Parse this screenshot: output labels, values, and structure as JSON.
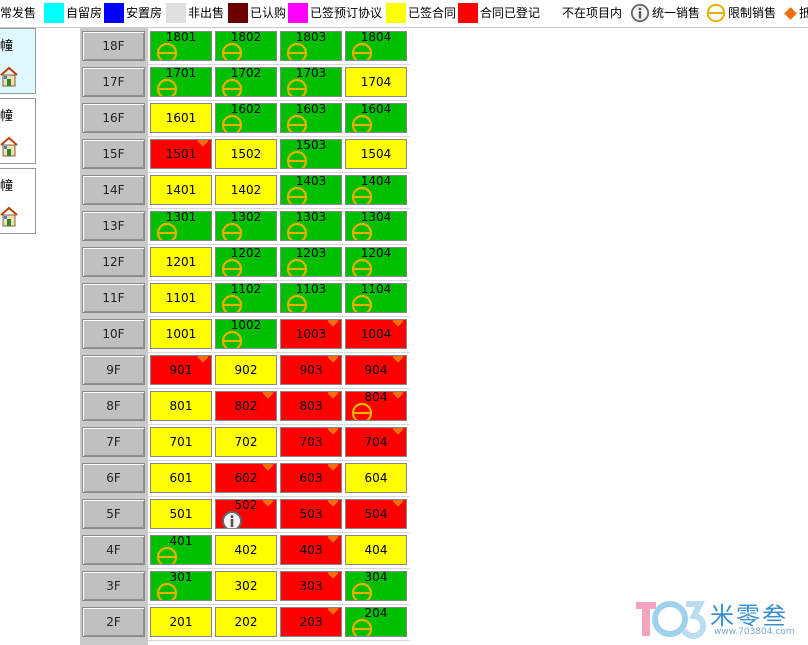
{
  "legend": {
    "items": [
      {
        "label": "正常发售",
        "color": "#00c000",
        "swatch": false
      },
      {
        "label": "自留房",
        "color": "#00ffff",
        "swatch": true
      },
      {
        "label": "安置房",
        "color": "#0000ff",
        "swatch": true
      },
      {
        "label": "非出售",
        "color": "#e0e0e0",
        "swatch": true
      },
      {
        "label": "已认购",
        "color": "#6a0000",
        "swatch": true
      },
      {
        "label": "已签预订协议",
        "color": "#ff00ff",
        "swatch": true
      },
      {
        "label": "已签合同",
        "color": "#ffff00",
        "swatch": true
      },
      {
        "label": "合同已登记",
        "color": "#ff0000",
        "swatch": true
      },
      {
        "label": "不在项目内",
        "color": "#ffffff",
        "swatch": true
      },
      {
        "label": "统一销售",
        "icon": "info-icon"
      },
      {
        "label": "限制销售",
        "icon": "restrict-icon"
      },
      {
        "label": "抵",
        "icon": "diamond-icon"
      }
    ]
  },
  "buildings": [
    {
      "label": "幢",
      "active": true
    },
    {
      "label": "幢",
      "active": false
    },
    {
      "label": "幢",
      "active": false
    }
  ],
  "colors": {
    "green": "#00bf00",
    "yellow": "#ffff00",
    "red": "#ff0000"
  },
  "floors": [
    {
      "label": "18F",
      "units": [
        {
          "num": "1801",
          "status": "green",
          "restrict": true
        },
        {
          "num": "1802",
          "status": "green",
          "restrict": true
        },
        {
          "num": "1803",
          "status": "green",
          "restrict": true
        },
        {
          "num": "1804",
          "status": "green",
          "restrict": true
        }
      ]
    },
    {
      "label": "17F",
      "units": [
        {
          "num": "1701",
          "status": "green",
          "restrict": true
        },
        {
          "num": "1702",
          "status": "green",
          "restrict": true
        },
        {
          "num": "1703",
          "status": "green",
          "restrict": true
        },
        {
          "num": "1704",
          "status": "yellow"
        }
      ]
    },
    {
      "label": "16F",
      "units": [
        {
          "num": "1601",
          "status": "yellow"
        },
        {
          "num": "1602",
          "status": "green",
          "restrict": true
        },
        {
          "num": "1603",
          "status": "green",
          "restrict": true
        },
        {
          "num": "1604",
          "status": "green",
          "restrict": true
        }
      ]
    },
    {
      "label": "15F",
      "units": [
        {
          "num": "1501",
          "status": "red",
          "diamond": true
        },
        {
          "num": "1502",
          "status": "yellow"
        },
        {
          "num": "1503",
          "status": "green",
          "restrict": true
        },
        {
          "num": "1504",
          "status": "yellow"
        }
      ]
    },
    {
      "label": "14F",
      "units": [
        {
          "num": "1401",
          "status": "yellow"
        },
        {
          "num": "1402",
          "status": "yellow"
        },
        {
          "num": "1403",
          "status": "green",
          "restrict": true
        },
        {
          "num": "1404",
          "status": "green",
          "restrict": true
        }
      ]
    },
    {
      "label": "13F",
      "units": [
        {
          "num": "1301",
          "status": "green",
          "restrict": true
        },
        {
          "num": "1302",
          "status": "green",
          "restrict": true
        },
        {
          "num": "1303",
          "status": "green",
          "restrict": true
        },
        {
          "num": "1304",
          "status": "green",
          "restrict": true
        }
      ]
    },
    {
      "label": "12F",
      "units": [
        {
          "num": "1201",
          "status": "yellow"
        },
        {
          "num": "1202",
          "status": "green",
          "restrict": true
        },
        {
          "num": "1203",
          "status": "green",
          "restrict": true
        },
        {
          "num": "1204",
          "status": "green",
          "restrict": true
        }
      ]
    },
    {
      "label": "11F",
      "units": [
        {
          "num": "1101",
          "status": "yellow"
        },
        {
          "num": "1102",
          "status": "green",
          "restrict": true
        },
        {
          "num": "1103",
          "status": "green",
          "restrict": true
        },
        {
          "num": "1104",
          "status": "green",
          "restrict": true
        }
      ]
    },
    {
      "label": "10F",
      "units": [
        {
          "num": "1001",
          "status": "yellow"
        },
        {
          "num": "1002",
          "status": "green",
          "restrict": true
        },
        {
          "num": "1003",
          "status": "red",
          "diamond": true
        },
        {
          "num": "1004",
          "status": "red",
          "diamond": true
        }
      ]
    },
    {
      "label": "9F",
      "units": [
        {
          "num": "901",
          "status": "red",
          "diamond": true
        },
        {
          "num": "902",
          "status": "yellow"
        },
        {
          "num": "903",
          "status": "red",
          "diamond": true
        },
        {
          "num": "904",
          "status": "red",
          "diamond": true
        }
      ]
    },
    {
      "label": "8F",
      "units": [
        {
          "num": "801",
          "status": "yellow"
        },
        {
          "num": "802",
          "status": "red",
          "diamond": true
        },
        {
          "num": "803",
          "status": "red",
          "diamond": true
        },
        {
          "num": "804",
          "status": "red",
          "diamond": true,
          "restrict": true
        }
      ]
    },
    {
      "label": "7F",
      "units": [
        {
          "num": "701",
          "status": "yellow"
        },
        {
          "num": "702",
          "status": "yellow"
        },
        {
          "num": "703",
          "status": "red",
          "diamond": true
        },
        {
          "num": "704",
          "status": "red",
          "diamond": true
        }
      ]
    },
    {
      "label": "6F",
      "units": [
        {
          "num": "601",
          "status": "yellow"
        },
        {
          "num": "602",
          "status": "red",
          "diamond": true
        },
        {
          "num": "603",
          "status": "red",
          "diamond": true
        },
        {
          "num": "604",
          "status": "yellow"
        }
      ]
    },
    {
      "label": "5F",
      "units": [
        {
          "num": "501",
          "status": "yellow"
        },
        {
          "num": "502",
          "status": "red",
          "diamond": true,
          "info": true
        },
        {
          "num": "503",
          "status": "red",
          "diamond": true
        },
        {
          "num": "504",
          "status": "red",
          "diamond": true
        }
      ]
    },
    {
      "label": "4F",
      "units": [
        {
          "num": "401",
          "status": "green",
          "restrict": true
        },
        {
          "num": "402",
          "status": "yellow"
        },
        {
          "num": "403",
          "status": "red",
          "diamond": true
        },
        {
          "num": "404",
          "status": "yellow"
        }
      ]
    },
    {
      "label": "3F",
      "units": [
        {
          "num": "301",
          "status": "green",
          "restrict": true
        },
        {
          "num": "302",
          "status": "yellow"
        },
        {
          "num": "303",
          "status": "red",
          "diamond": true
        },
        {
          "num": "304",
          "status": "green",
          "restrict": true
        }
      ]
    },
    {
      "label": "2F",
      "units": [
        {
          "num": "201",
          "status": "yellow"
        },
        {
          "num": "202",
          "status": "yellow"
        },
        {
          "num": "203",
          "status": "red",
          "diamond": true
        },
        {
          "num": "204",
          "status": "green",
          "restrict": true
        }
      ]
    }
  ],
  "watermark": {
    "brand": "米零叁",
    "url": "www.703804.com"
  }
}
